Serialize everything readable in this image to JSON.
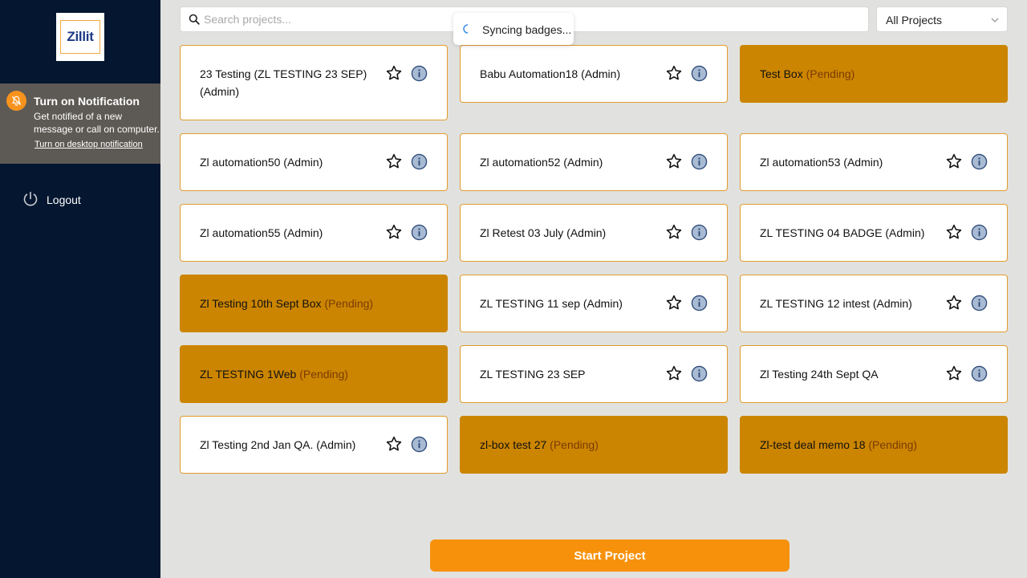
{
  "app": {
    "logo_text": "Zillit",
    "accent_color": "#f7910c",
    "pending_color": "#cc8500",
    "sidebar_color": "#041630"
  },
  "sidebar": {
    "notification": {
      "title": "Turn on Notification",
      "text": "Get notified of a new message or call on computer.",
      "link": "Turn on desktop notification",
      "icon": "bell-off-icon"
    },
    "logout_label": "Logout",
    "logout_icon": "power-icon"
  },
  "search": {
    "placeholder": "Search projects...",
    "value": ""
  },
  "filter": {
    "selected": "All Projects"
  },
  "toast": {
    "text": "Syncing badges..."
  },
  "projects": [
    {
      "name": "23 Testing (ZL TESTING 23 SEP) (Admin)",
      "status": "active"
    },
    {
      "name": "Babu Automation18 (Admin)",
      "status": "active"
    },
    {
      "name": "Test Box",
      "status": "pending",
      "tag": "(Pending)"
    },
    {
      "name": "Zl automation50 (Admin)",
      "status": "active"
    },
    {
      "name": "Zl automation52 (Admin)",
      "status": "active"
    },
    {
      "name": "Zl automation53 (Admin)",
      "status": "active"
    },
    {
      "name": "Zl automation55 (Admin)",
      "status": "active"
    },
    {
      "name": "Zl Retest 03 July (Admin)",
      "status": "active"
    },
    {
      "name": "ZL TESTING 04 BADGE (Admin)",
      "status": "active"
    },
    {
      "name": "Zl Testing 10th Sept Box",
      "status": "pending",
      "tag": "(Pending)"
    },
    {
      "name": "ZL TESTING 11 sep (Admin)",
      "status": "active"
    },
    {
      "name": "ZL TESTING 12 intest (Admin)",
      "status": "active"
    },
    {
      "name": "ZL TESTING 1Web",
      "status": "pending",
      "tag": "(Pending)"
    },
    {
      "name": "ZL TESTING 23 SEP",
      "status": "active"
    },
    {
      "name": "Zl Testing 24th Sept QA",
      "status": "active"
    },
    {
      "name": "Zl Testing 2nd Jan QA. (Admin)",
      "status": "active"
    },
    {
      "name": "zl-box test 27",
      "status": "pending",
      "tag": "(Pending)"
    },
    {
      "name": "Zl-test deal memo 18",
      "status": "pending",
      "tag": "(Pending)"
    }
  ],
  "start_button": {
    "label": "Start Project"
  }
}
